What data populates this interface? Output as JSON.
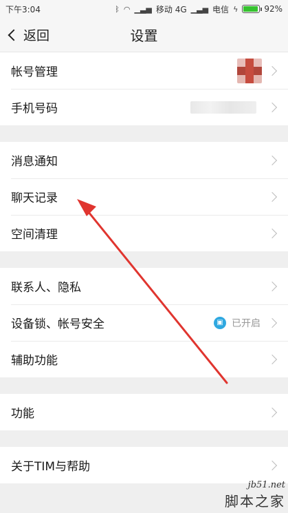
{
  "status_bar": {
    "time": "下午3:04",
    "carrier1": "移动 4G",
    "carrier2": "电信",
    "battery_percent": "92%",
    "battery_level": 0.92
  },
  "nav": {
    "back_label": "返回",
    "title": "设置"
  },
  "groups": [
    {
      "rows": [
        {
          "label": "帐号管理",
          "trailing": "avatar"
        },
        {
          "label": "手机号码",
          "trailing": "phone"
        }
      ]
    },
    {
      "rows": [
        {
          "label": "消息通知"
        },
        {
          "label": "聊天记录"
        },
        {
          "label": "空间清理"
        }
      ]
    },
    {
      "rows": [
        {
          "label": "联系人、隐私"
        },
        {
          "label": "设备锁、帐号安全",
          "value": "已开启"
        },
        {
          "label": "辅助功能"
        }
      ]
    },
    {
      "rows": [
        {
          "label": "功能"
        }
      ]
    },
    {
      "rows": [
        {
          "label": "关于TIM与帮助"
        }
      ]
    }
  ],
  "icons": {
    "bluetooth": "bluetooth-icon",
    "wifi": "wifi-icon",
    "signal": "signal-icon",
    "charging": "charging-icon",
    "lock": "lock-icon"
  },
  "colors": {
    "accent": "#2fa8e0",
    "battery": "#36c230",
    "arrow": "#e0352f"
  },
  "watermark": {
    "site": "jb51.net",
    "name": "脚本之家"
  }
}
